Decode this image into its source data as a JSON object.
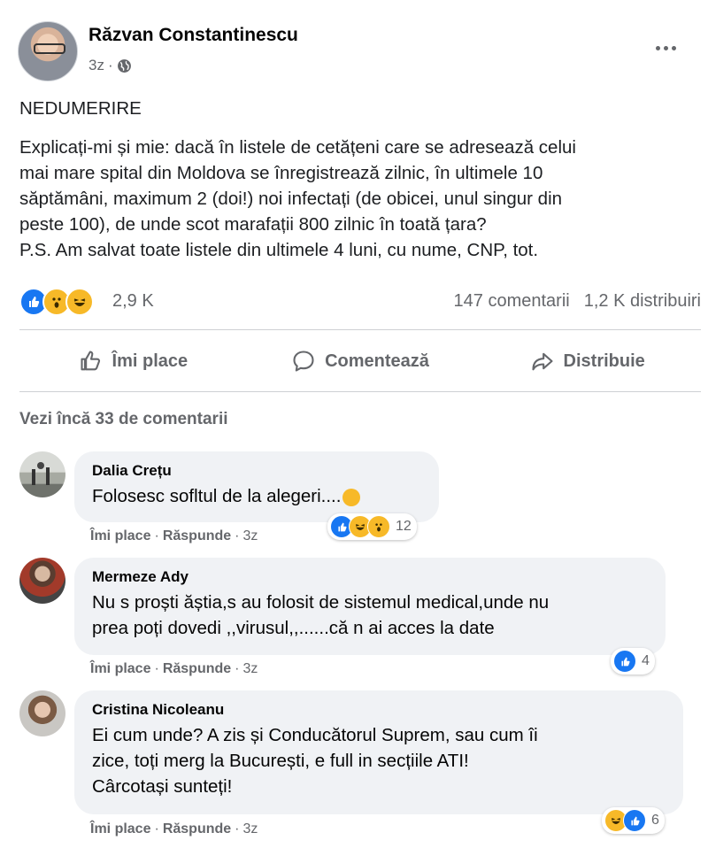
{
  "post": {
    "author": "Răzvan Constantinescu",
    "time": "3z",
    "title": "NEDUMERIRE",
    "body_lines": [
      "Explicați-mi și mie: dacă în listele de cetățeni care se adresează celui",
      "mai mare spital din Moldova se înregistrează zilnic, în ultimele 10",
      "săptămâni, maximum 2 (doi!) noi infectați (de obicei, unul singur din",
      "peste 100), de unde scot marafații 800 zilnic în toată țara?",
      "P.S. Am salvat toate listele din ultimele 4 luni, cu nume, CNP, tot."
    ],
    "reactions": {
      "icons": [
        "like",
        "wow",
        "haha"
      ],
      "count": "2,9 K"
    },
    "comments_count": "147 comentarii",
    "shares_count": "1,2 K distribuiri"
  },
  "actions": {
    "like": "Îmi place",
    "comment": "Comentează",
    "share": "Distribuie"
  },
  "more_comments": "Vezi încă 33 de comentarii",
  "comments": [
    {
      "name": "Dalia Crețu",
      "text_lines": [
        "Folosesc sofltul de la alegeri...."
      ],
      "like": "Îmi place",
      "reply": "Răspunde",
      "time": "3z",
      "reactions": {
        "icons": [
          "like",
          "haha",
          "wow"
        ],
        "count": "12"
      }
    },
    {
      "name": "Mermeze Ady",
      "text_lines": [
        "Nu s proști ăștia,s au folosit de sistemul medical,unde nu",
        "prea poți dovedi ,,virusul,,......că n ai acces la date"
      ],
      "like": "Îmi place",
      "reply": "Răspunde",
      "time": "3z",
      "reactions": {
        "icons": [
          "like"
        ],
        "count": "4"
      }
    },
    {
      "name": "Cristina Nicoleanu",
      "text_lines": [
        "Ei cum unde? A zis și Conducătorul Suprem, sau cum îi",
        "zice, toți merg la București, e full in secțiile ATI!",
        "Cârcotași sunteți!"
      ],
      "like": "Îmi place",
      "reply": "Răspunde",
      "time": "3z",
      "reactions": {
        "icons": [
          "haha",
          "like"
        ],
        "count": "6"
      }
    }
  ],
  "colors": {
    "like_blue": "#1877f2",
    "emoji_yellow": "#f7b928",
    "secondary_text": "#65676b",
    "bubble_bg": "#f0f2f5"
  }
}
